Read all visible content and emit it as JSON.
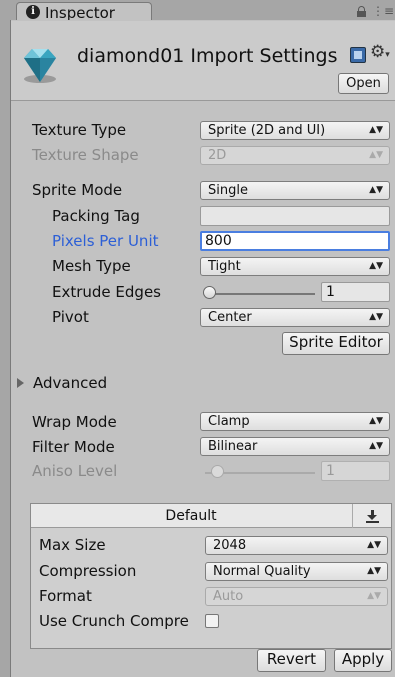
{
  "window": {
    "tab_label": "Inspector",
    "tab_icon_glyph": "i"
  },
  "header": {
    "title": "diamond01 Import Settings",
    "open_button": "Open",
    "icons": [
      "gem-icon",
      "book-icon",
      "gear-icon",
      "lock-icon",
      "panel-menu-icon"
    ]
  },
  "fields": {
    "texture_type": {
      "label": "Texture Type",
      "value": "Sprite (2D and UI)"
    },
    "texture_shape": {
      "label": "Texture Shape",
      "value": "2D"
    },
    "sprite_mode": {
      "label": "Sprite Mode",
      "value": "Single"
    },
    "packing_tag": {
      "label": "Packing Tag",
      "value": ""
    },
    "pixels_per_unit": {
      "label": "Pixels Per Unit",
      "value": "800"
    },
    "mesh_type": {
      "label": "Mesh Type",
      "value": "Tight"
    },
    "extrude_edges": {
      "label": "Extrude Edges",
      "value": "1",
      "slider_fraction": 0.03
    },
    "pivot": {
      "label": "Pivot",
      "value": "Center"
    },
    "sprite_editor_button": "Sprite Editor",
    "advanced": "Advanced",
    "wrap_mode": {
      "label": "Wrap Mode",
      "value": "Clamp"
    },
    "filter_mode": {
      "label": "Filter Mode",
      "value": "Bilinear"
    },
    "aniso_level": {
      "label": "Aniso Level",
      "value": "1",
      "slider_fraction": 0.1
    }
  },
  "platform": {
    "tab_label": "Default",
    "max_size": {
      "label": "Max Size",
      "value": "2048"
    },
    "compression": {
      "label": "Compression",
      "value": "Normal Quality"
    },
    "format": {
      "label": "Format",
      "value": "Auto"
    },
    "use_crunch": {
      "label": "Use Crunch Compre",
      "checked": false
    }
  },
  "footer": {
    "revert_button": "Revert",
    "apply_button": "Apply"
  },
  "colors": {
    "panel_bg": "#c2c2c2",
    "highlight_label": "#2c5fd6",
    "focus_border": "#4a7ee0"
  }
}
